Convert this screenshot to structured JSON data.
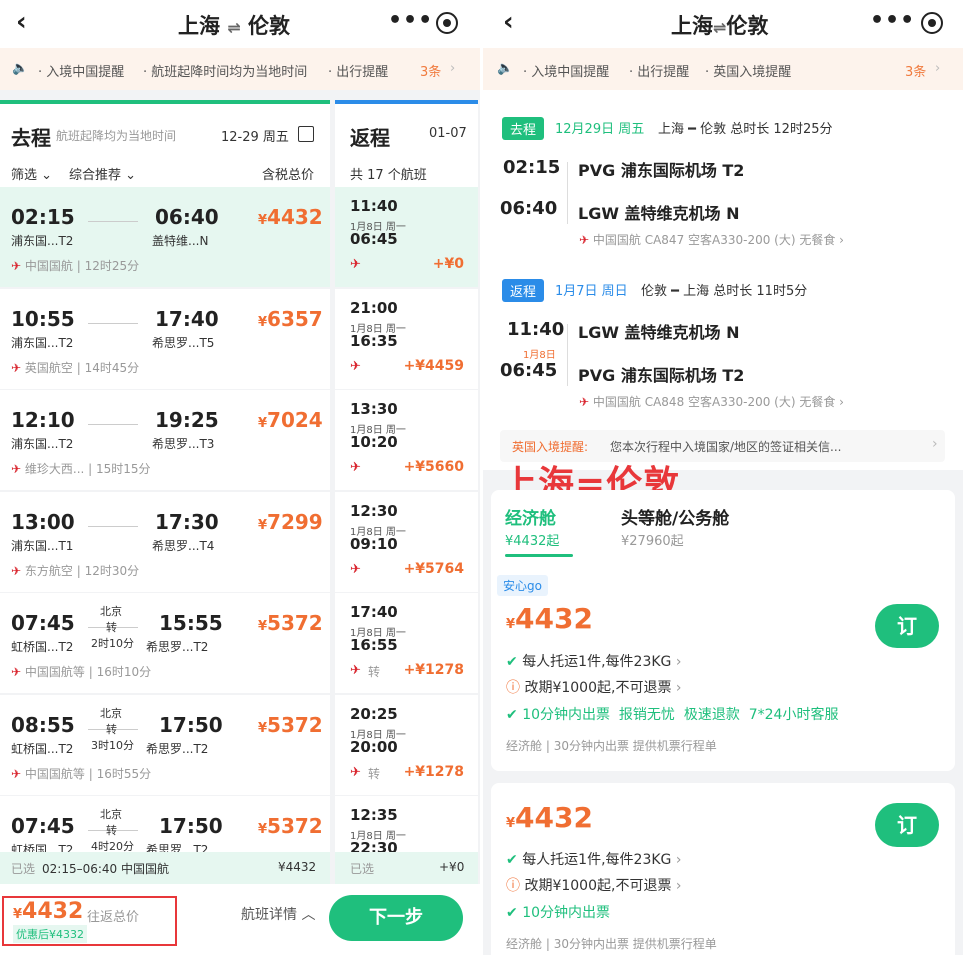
{
  "left": {
    "header": {
      "title_from": "上海",
      "title_to": "伦敦",
      "swap_symbol": "⇌"
    },
    "notice": {
      "items": [
        "入境中国提醒",
        "航班起降时间均为当地时间",
        "出行提醒"
      ],
      "count": "3条"
    },
    "outbound": {
      "label": "去程",
      "hint": "航班起降均为当地时间",
      "date": "12-29 周五",
      "filter": "筛选",
      "sort": "综合推荐",
      "price_note": "含税总价"
    },
    "return_col": {
      "label": "返程",
      "date": "01-07",
      "count": "共 17 个航班"
    },
    "flights": [
      {
        "dep": "02:15",
        "arr": "06:40",
        "dep_ap": "浦东国...T2",
        "arr_ap": "盖特维...N",
        "price": "4432",
        "airline": "中国国航",
        "duration": "12时25分",
        "stop_city": "",
        "stop_text": "",
        "stop_dur": "",
        "selected": true
      },
      {
        "dep": "10:55",
        "arr": "17:40",
        "dep_ap": "浦东国...T2",
        "arr_ap": "希思罗...T5",
        "price": "6357",
        "airline": "英国航空",
        "duration": "14时45分",
        "stop_city": "",
        "stop_text": "",
        "stop_dur": "",
        "selected": false
      },
      {
        "dep": "12:10",
        "arr": "19:25",
        "dep_ap": "浦东国...T2",
        "arr_ap": "希思罗...T3",
        "price": "7024",
        "airline": "维珍大西...",
        "duration": "15时15分",
        "stop_city": "",
        "stop_text": "",
        "stop_dur": "",
        "selected": false
      },
      {
        "dep": "13:00",
        "arr": "17:30",
        "dep_ap": "浦东国...T1",
        "arr_ap": "希思罗...T4",
        "price": "7299",
        "airline": "东方航空",
        "duration": "12时30分",
        "stop_city": "",
        "stop_text": "",
        "stop_dur": "",
        "selected": false
      },
      {
        "dep": "07:45",
        "arr": "15:55",
        "dep_ap": "虹桥国...T2",
        "arr_ap": "希思罗...T2",
        "price": "5372",
        "airline": "中国国航等",
        "duration": "16时10分",
        "stop_city": "北京",
        "stop_text": "转",
        "stop_dur": "2时10分",
        "selected": false
      },
      {
        "dep": "08:55",
        "arr": "17:50",
        "dep_ap": "虹桥国...T2",
        "arr_ap": "希思罗...T2",
        "price": "5372",
        "airline": "中国国航等",
        "duration": "16时55分",
        "stop_city": "北京",
        "stop_text": "转",
        "stop_dur": "3时10分",
        "selected": false
      },
      {
        "dep": "07:45",
        "arr": "17:50",
        "dep_ap": "虹桥国...T2",
        "arr_ap": "希思罗...T2",
        "price": "5372",
        "airline": "",
        "duration": "",
        "stop_city": "北京",
        "stop_text": "转",
        "stop_dur": "4时20分",
        "selected": false
      }
    ],
    "returns": [
      {
        "dep": "11:40",
        "date": "1月8日 周一",
        "arr": "06:45",
        "extra": "+¥0",
        "transfer": ""
      },
      {
        "dep": "21:00",
        "date": "1月8日 周一",
        "arr": "16:35",
        "extra": "+¥4459",
        "transfer": ""
      },
      {
        "dep": "13:30",
        "date": "1月8日 周一",
        "arr": "10:20",
        "extra": "+¥5660",
        "transfer": ""
      },
      {
        "dep": "12:30",
        "date": "1月8日 周一",
        "arr": "09:10",
        "extra": "+¥5764",
        "transfer": ""
      },
      {
        "dep": "17:40",
        "date": "1月8日 周一",
        "arr": "16:55",
        "extra": "+¥1278",
        "transfer": "转"
      },
      {
        "dep": "20:25",
        "date": "1月8日 周一",
        "arr": "20:00",
        "extra": "+¥1278",
        "transfer": "转"
      },
      {
        "dep": "12:35",
        "date": "1月8日 周一",
        "arr": "22:30",
        "extra": "",
        "transfer": ""
      }
    ],
    "selected_bar": {
      "label": "已选",
      "info": "02:15–06:40 中国国航",
      "price": "¥4432",
      "ret_label": "已选",
      "ret_price": "+¥0"
    },
    "footer": {
      "yen": "¥",
      "price": "4432",
      "price_label": "往返总价",
      "discount": "优惠后¥4332",
      "details": "航班详情",
      "next": "下一步"
    }
  },
  "right": {
    "header": {
      "title_from": "上海",
      "title_to": "伦敦",
      "swap_symbol": "⇌"
    },
    "notice": {
      "items": [
        "入境中国提醒",
        "出行提醒",
        "英国入境提醒"
      ],
      "count": "3条"
    },
    "outbound": {
      "tag": "去程",
      "date": "12月29日 周五",
      "route_from": "上海",
      "route_to": "伦敦",
      "total": "总时长 12时25分",
      "dep_time": "02:15",
      "dep_airport": "PVG 浦东国际机场 T2",
      "arr_time": "06:40",
      "arr_airport": "LGW 盖特维克机场 N",
      "flight_info": "中国国航 CA847  空客A330-200 (大)  无餐食"
    },
    "return": {
      "tag": "返程",
      "date": "1月7日 周日",
      "route_from": "伦敦",
      "route_to": "上海",
      "total": "总时长 11时5分",
      "dep_time": "11:40",
      "dep_airport": "LGW 盖特维克机场 N",
      "next_day": "1月8日",
      "arr_time": "06:45",
      "arr_airport": "PVG 浦东国际机场 T2",
      "flight_info": "中国国航 CA848  空客A330-200 (大)  无餐食"
    },
    "uk_notice": {
      "label": "英国入境提醒:",
      "text": "您本次行程中入境国家/地区的签证相关信..."
    },
    "overlay_title": "上海=伦敦",
    "cabins": [
      {
        "name": "经济舱",
        "price": "¥4432起"
      },
      {
        "name": "头等舱/公务舱",
        "price": "¥27960起"
      }
    ],
    "offers": [
      {
        "badge": "安心go",
        "yen": "¥",
        "price": "4432",
        "book": "订",
        "baggage": "每人托运1件,每件23KG",
        "change": "改期¥1000起,不可退票",
        "features": [
          "10分钟内出票",
          "报销无忧",
          "极速退款",
          "7*24小时客服"
        ],
        "meta": [
          "经济舱",
          "30分钟内出票",
          "提供机票行程单"
        ]
      },
      {
        "badge": "",
        "yen": "¥",
        "price": "4432",
        "book": "订",
        "baggage": "每人托运1件,每件23KG",
        "change": "改期¥1000起,不可退票",
        "features": [
          "10分钟内出票"
        ],
        "meta": [
          "经济舱",
          "30分钟内出票",
          "提供机票行程单"
        ]
      }
    ]
  },
  "colors": {
    "accent": "#1fbf7d",
    "price": "#f06e32",
    "blue": "#2b8ce8",
    "highlight_bg": "#e6f7f0",
    "red_box": "#e8373a"
  }
}
